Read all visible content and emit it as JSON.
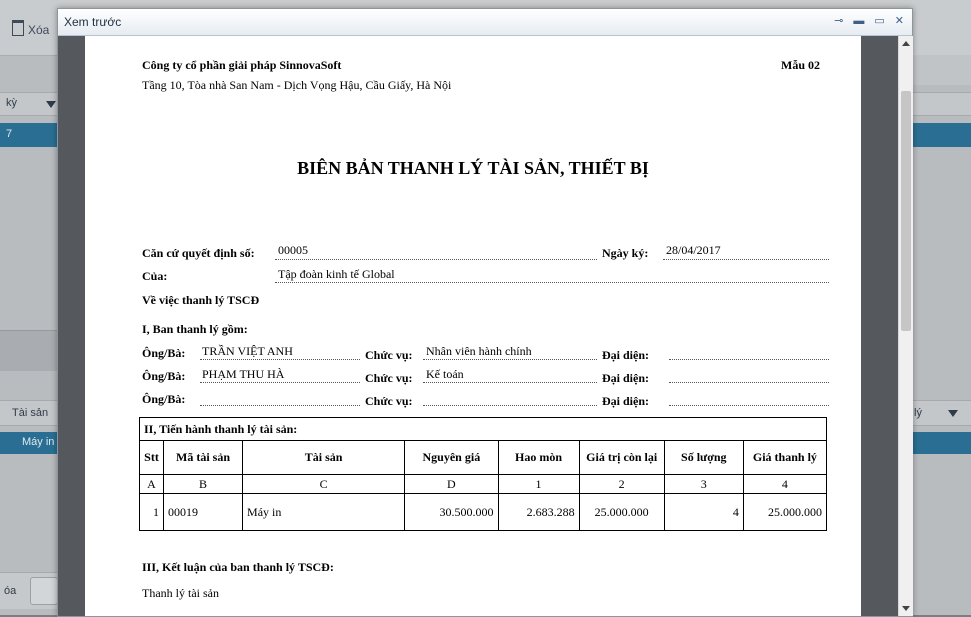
{
  "background": {
    "delete_label": "Xóa",
    "col_left_header": "kỳ",
    "row_left_value": "7",
    "col_tai_san": "Tài sản",
    "row_may_in": "Máy in",
    "col_right_header": "lý",
    "bottom_left_label": "óa"
  },
  "window": {
    "title": "Xem trước"
  },
  "doc": {
    "company": "Công ty cổ phần giải pháp SinnovaSoft",
    "address": "Tầng 10, Tòa nhà San Nam - Dịch Vọng Hậu, Cầu Giấy, Hà Nội",
    "form_code": "Mẫu 02",
    "title": "BIÊN BẢN THANH LÝ TÀI SẢN, THIẾT BỊ",
    "decision_label": "Căn cứ quyết định số:",
    "decision_no": "00005",
    "sign_date_label": "Ngày ký:",
    "sign_date": "28/04/2017",
    "of_label": "Của:",
    "of_value": "Tập đoàn kinh tế Global",
    "subject": "Về việc thanh lý TSCĐ",
    "section1": "I, Ban thanh lý gồm:",
    "member_label": "Ông/Bà:",
    "position_label": "Chức vụ:",
    "rep_label": "Đại diện:",
    "members": [
      {
        "name": "TRẦN VIỆT ANH",
        "position": "Nhân viên hành chính",
        "rep": ""
      },
      {
        "name": "PHẠM THU HÀ",
        "position": "Kế toán",
        "rep": ""
      },
      {
        "name": "",
        "position": "",
        "rep": ""
      }
    ],
    "section2": "II, Tiến hành thanh lý tài sản:",
    "table": {
      "headers": [
        "Stt",
        "Mã tài sản",
        "Tài sản",
        "Nguyên giá",
        "Hao mòn",
        "Giá trị còn lại",
        "Số lượng",
        "Giá thanh lý"
      ],
      "letters": [
        "A",
        "B",
        "C",
        "D",
        "1",
        "2",
        "3",
        "4"
      ],
      "rows": [
        [
          "1",
          "00019",
          "Máy in",
          "30.500.000",
          "2.683.288",
          "25.000.000",
          "4",
          "25.000.000"
        ]
      ]
    },
    "section3": "III, Kết luận của ban thanh lý TSCĐ:",
    "conclusion": "Thanh lý tài sản"
  }
}
